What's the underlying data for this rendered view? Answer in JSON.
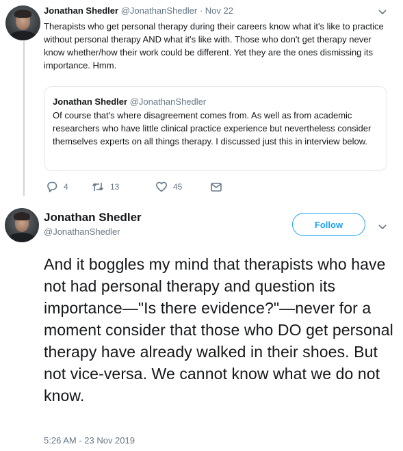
{
  "reply_tweet": {
    "author_name": "Jonathan Shedler",
    "author_handle": "@JonathanShedler",
    "separator": "·",
    "date": "Nov 22",
    "text": "Therapists who get personal therapy during their careers know what it's like to practice without personal therapy AND what it's like with. Those who don't get therapy never know whether/how their work could be different. Yet they are the ones dismissing its importance. Hmm.",
    "quoted": {
      "author_name": "Jonathan Shedler",
      "author_handle": "@JonathanShedler",
      "text": "Of course that's where disagreement comes from. As well as from academic researchers who have little clinical practice experience but nevertheless consider themselves experts on all things therapy. I discussed just this in interview below."
    },
    "actions": {
      "replies": "4",
      "retweets": "13",
      "likes": "45"
    }
  },
  "main_tweet": {
    "author_name": "Jonathan Shedler",
    "author_handle": "@JonathanShedler",
    "follow_label": "Follow",
    "text": "And it boggles my mind that therapists who have not had personal therapy and question its importance—\"Is there evidence?\"—never for a moment consider that those who DO get personal therapy have already walked in their shoes. But not vice-versa. We cannot know what we do not know.",
    "timestamp": "5:26 AM - 23 Nov 2019"
  },
  "icons": {
    "reply": "reply-icon",
    "retweet": "retweet-icon",
    "like": "heart-icon",
    "message": "envelope-icon",
    "menu": "chevron-down-icon"
  },
  "colors": {
    "accent": "#1da1f2",
    "secondary_text": "#657786",
    "border": "#e1e8ed"
  }
}
